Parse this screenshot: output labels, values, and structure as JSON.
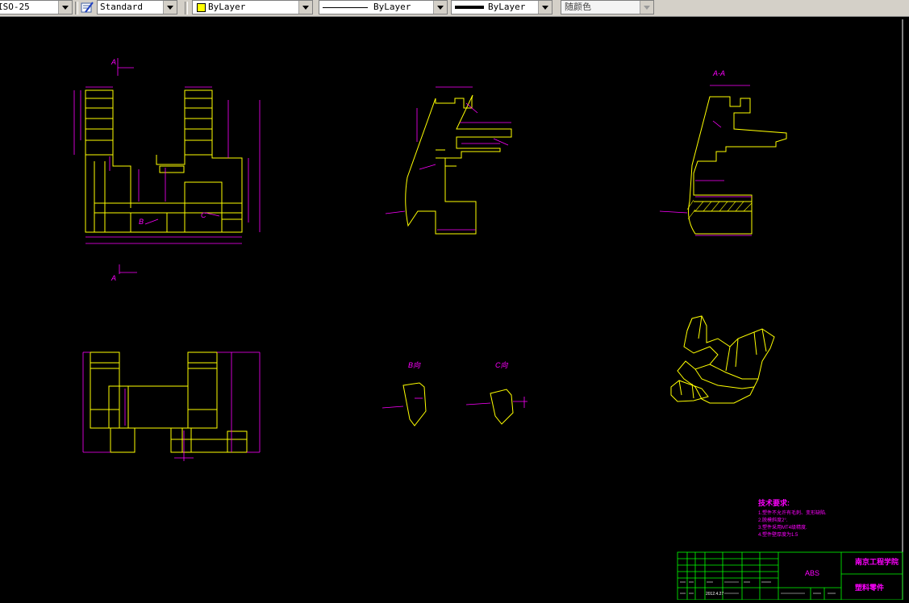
{
  "toolbar": {
    "dimstyle": "ISO-25",
    "textstyle": "Standard",
    "layer_color": "ByLayer",
    "linetype": "ByLayer",
    "lineweight": "ByLayer",
    "plotstyle": "随颜色",
    "colors": {
      "layer_swatch": "#ffff00",
      "toolbar_bg": "#d4d0c8"
    }
  },
  "drawing": {
    "colors": {
      "outline": "#ffff00",
      "dimension": "#ff00ff",
      "border": "#ffffff",
      "titleblock": "#00ff00"
    },
    "labels": {
      "section_mark_top": "A",
      "section_mark_bottom": "A",
      "section_title": "A-A",
      "label_b": "B",
      "label_c": "C",
      "view_b": "B向",
      "view_c": "C向"
    },
    "tech_requirements": {
      "title": "技术要求:",
      "lines": [
        "1.塑件不允许有毛刺、变形缺陷.",
        "2.脱模斜度2°.",
        "3.塑件采用MT4级精度.",
        "4.塑件壁厚度为1.5"
      ]
    },
    "title_block": {
      "material": "ABS",
      "school": "南京工程学院",
      "part_name": "塑料零件",
      "date": "2012.4.27"
    }
  }
}
